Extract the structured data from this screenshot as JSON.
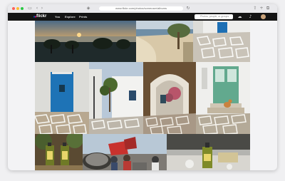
{
  "browser": {
    "url": "www.flickr.com/photos/someuser/albums",
    "traffic_lights": [
      "#ff5f57",
      "#febc2e",
      "#28c840"
    ]
  },
  "nav": {
    "logo_text": "flickr",
    "links": [
      "You",
      "Explore",
      "Prints"
    ],
    "search_placeholder": "Photos, people, or groups",
    "icons": [
      "upload-icon",
      "bell-icon",
      "avatar"
    ]
  },
  "photos": [
    {
      "name": "photo-sunset-harbor",
      "subject": "sunset harbor"
    },
    {
      "name": "photo-beach-bay",
      "subject": "beach bay"
    },
    {
      "name": "photo-blue-door-terrace",
      "subject": "blue door terrace"
    },
    {
      "name": "photo-blue-door-wall",
      "subject": "blue door"
    },
    {
      "name": "photo-white-street-tree",
      "subject": "white street tree"
    },
    {
      "name": "photo-archway-alley",
      "subject": "archway alley"
    },
    {
      "name": "photo-green-door-cat",
      "subject": "green door cat"
    },
    {
      "name": "photo-olive-oil-bottles",
      "subject": "olive oil bottles"
    },
    {
      "name": "photo-fishermen-nets",
      "subject": "fishermen nets"
    },
    {
      "name": "photo-olive-oil-table",
      "subject": "olive oil table"
    }
  ]
}
